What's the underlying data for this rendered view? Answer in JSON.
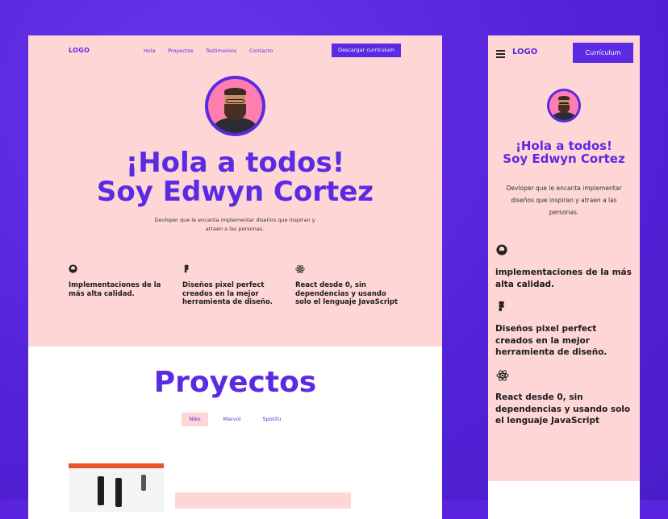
{
  "desktop": {
    "logo": "LOGO",
    "nav": [
      "Hola",
      "Proyectos",
      "Testimonios",
      "Contacto"
    ],
    "cta": "Descargar currículum",
    "heading_line1": "¡Hola a todos!",
    "heading_line2": "Soy Edwyn Cortez",
    "subtitle": "Devloper que le encanta implementar diseños que inspiran y atraen a las personas.",
    "features": [
      {
        "icon": "github-icon",
        "text": "Implementaciones de la más alta calidad."
      },
      {
        "icon": "figma-icon",
        "text": "Diseños pixel perfect creados en la mejor herramienta de diseño."
      },
      {
        "icon": "react-icon",
        "text": "React desde 0, sin dependencias y usando solo el lenguaje JavaScript"
      }
    ],
    "projects_title": "Proyectos",
    "tabs": [
      "Niko",
      "Marvol",
      "Spotifu"
    ],
    "active_tab": "Niko"
  },
  "mobile": {
    "logo": "LOGO",
    "cta": "Currículum",
    "heading_line1": "¡Hola a todos!",
    "heading_line2": "Soy Edwyn Cortez",
    "subtitle": "Devloper que le encanta implementar diseños que inspiran y atraen a las personas.",
    "features": [
      {
        "icon": "github-icon",
        "text": "implementaciones de la más alta calidad."
      },
      {
        "icon": "figma-icon",
        "text": "Diseños pixel perfect creados en la mejor herramienta de diseño."
      },
      {
        "icon": "react-icon",
        "text": "React desde 0, sin dependencias y usando solo el lenguaje JavaScript"
      }
    ]
  },
  "colors": {
    "accent": "#5b2ae3",
    "pink": "#ffd6d6",
    "background": "#5b25e0"
  }
}
